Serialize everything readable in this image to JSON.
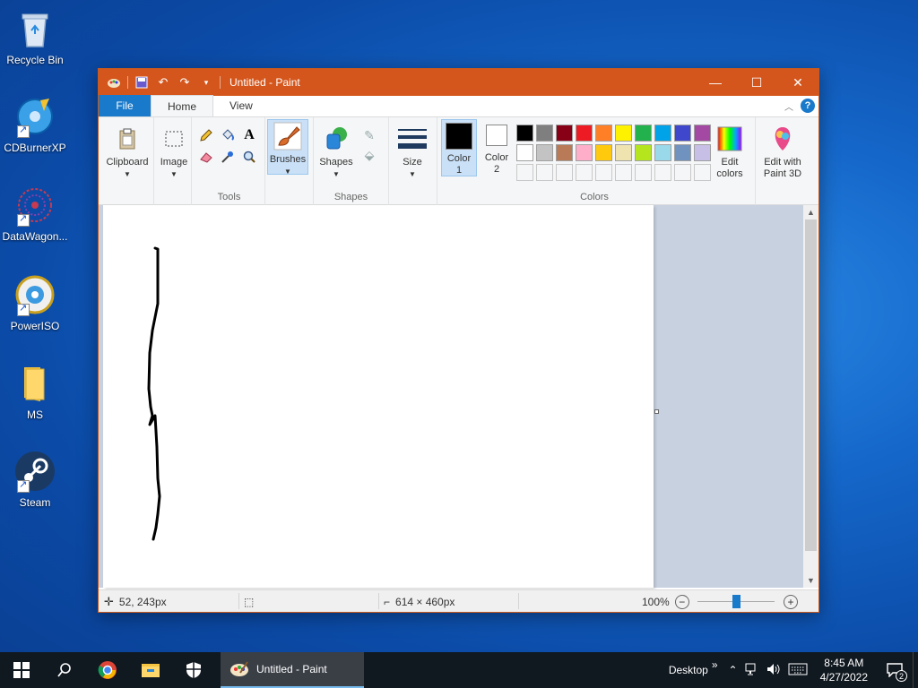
{
  "desktop": {
    "icons": [
      {
        "label": "Recycle Bin",
        "icon": "recycle-bin-icon"
      },
      {
        "label": "CDBurnerXP",
        "icon": "cdburnerxp-icon"
      },
      {
        "label": "DataWagon...",
        "icon": "datawagon-icon"
      },
      {
        "label": "PowerISO",
        "icon": "poweriso-icon"
      },
      {
        "label": "MS",
        "icon": "folder-icon"
      },
      {
        "label": "Steam",
        "icon": "steam-icon"
      }
    ]
  },
  "window": {
    "title": "Untitled - Paint",
    "title_bar_color": "#d4561c",
    "controls": {
      "minimize": "—",
      "maximize": "☐",
      "close": "✕"
    }
  },
  "tabs": [
    {
      "label": "File"
    },
    {
      "label": "Home"
    },
    {
      "label": "View"
    }
  ],
  "ribbon": {
    "clipboard": {
      "label": "Clipboard"
    },
    "image": {
      "label": "Image"
    },
    "tools": {
      "label": "Tools"
    },
    "brushes": {
      "label": "Brushes"
    },
    "shapes": {
      "button_label": "Shapes",
      "group_label": "Shapes"
    },
    "size": {
      "label": "Size"
    },
    "color1": {
      "label_line1": "Color",
      "label_line2": "1",
      "value": "#000000"
    },
    "color2": {
      "label_line1": "Color",
      "label_line2": "2",
      "value": "#ffffff"
    },
    "colors_group_label": "Colors",
    "edit_colors": {
      "line1": "Edit",
      "line2": "colors"
    },
    "paint3d": {
      "line1": "Edit with",
      "line2": "Paint 3D"
    },
    "palette_row1": [
      "#000000",
      "#7f7f7f",
      "#880015",
      "#ed1c24",
      "#ff7f27",
      "#fff200",
      "#22b14c",
      "#00a2e8",
      "#3f48cc",
      "#a349a4"
    ],
    "palette_row2": [
      "#ffffff",
      "#c3c3c3",
      "#b97a57",
      "#ffaec9",
      "#ffc90e",
      "#efe4b0",
      "#b5e61d",
      "#99d9ea",
      "#7092be",
      "#c8bfe7"
    ]
  },
  "status": {
    "cursor_pos": "52, 243px",
    "image_size": "614 × 460px",
    "zoom": "100%",
    "zoom_slider_level": 0.5
  },
  "taskbar": {
    "active_app": "Untitled - Paint",
    "desktop_label": "Desktop",
    "chevron": "»",
    "time": "8:45 AM",
    "date": "4/27/2022",
    "notification_count": "2"
  }
}
